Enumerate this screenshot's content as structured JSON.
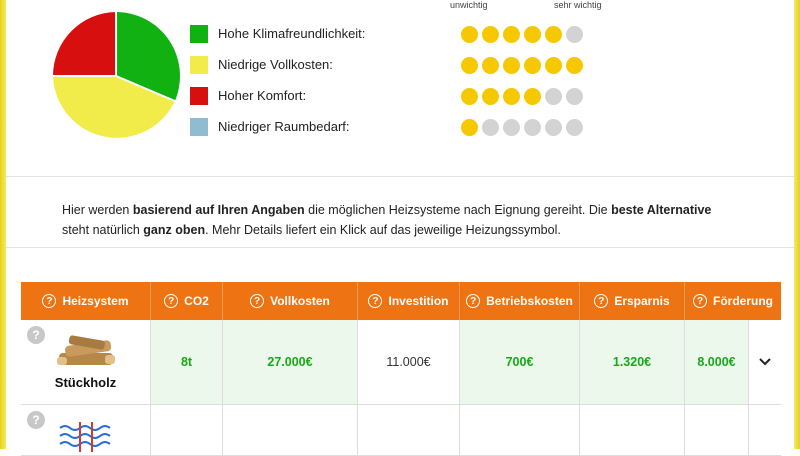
{
  "scale": {
    "left_label": "unwichtig",
    "right_label": "sehr wichtig"
  },
  "criteria": [
    {
      "label": "Hohe Klimafreundlichkeit:",
      "color": "#12b112",
      "rating": 5,
      "max": 6
    },
    {
      "label": "Niedrige Vollkosten:",
      "color": "#f2ec4a",
      "rating": 6,
      "max": 6
    },
    {
      "label": "Hoher Komfort:",
      "color": "#d80f0f",
      "rating": 4,
      "max": 6
    },
    {
      "label": "Niedriger Raumbedarf:",
      "color": "#8fbcd0",
      "rating": 1,
      "max": 6
    }
  ],
  "info": {
    "p1": "Hier werden ",
    "b1": "basierend auf Ihren Angaben",
    "p2": " die möglichen Heizsysteme nach Eignung gereiht. Die ",
    "b2": "beste Alternative",
    "p3": " steht natürlich ",
    "b3": "ganz oben",
    "p4": ". Mehr Details liefert ein Klick auf das jeweilige Heizungssymbol."
  },
  "table": {
    "headers": [
      "Heizsystem",
      "CO2",
      "Vollkosten",
      "Investition",
      "Betriebskosten",
      "Ersparnis",
      "Förderung"
    ],
    "rows": [
      {
        "name": "Stückholz",
        "co2": "8t",
        "vollkosten": "27.000€",
        "investition": "11.000€",
        "betriebskosten": "700€",
        "ersparnis": "1.320€",
        "foerderung": "8.000€"
      }
    ]
  },
  "icons": {
    "help": "?",
    "expand": "chevron-down-icon"
  }
}
